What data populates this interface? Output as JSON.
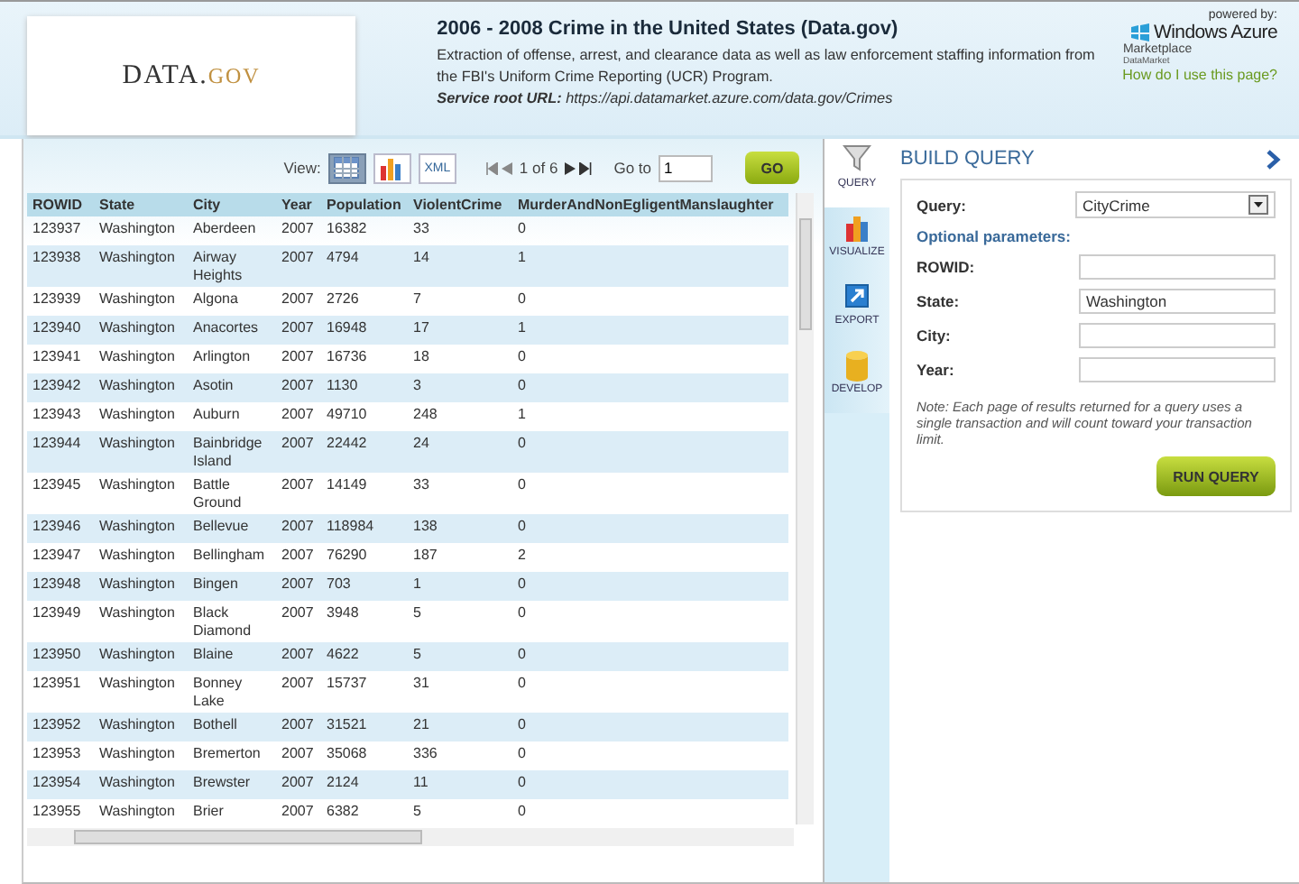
{
  "header": {
    "logo_main": "DATA.",
    "logo_accent": "GOV",
    "title": "2006 - 2008 Crime in the United States (Data.gov)",
    "description": "Extraction of offense, arrest, and clearance data as well as law enforcement staffing information from the FBI's Uniform Crime Reporting (UCR) Program.",
    "service_root": "**Service root URL:** https://api.datamarket.azure.com/data.gov/Crimes",
    "powered_by": "powered by:",
    "brand": "Windows Azure",
    "brand_sub": "Marketplace",
    "brand_sub2": "DataMarket",
    "help_link": "How do I use this page?"
  },
  "toolbar": {
    "view_label": "View:",
    "views": [
      {
        "kind": "table",
        "selected": true
      },
      {
        "kind": "chart",
        "selected": false
      },
      {
        "kind": "xml",
        "label": "XML",
        "selected": false
      }
    ],
    "page": "1 of 6",
    "goto_label": "Go to",
    "goto_value": "1",
    "go_button": "GO"
  },
  "table": {
    "columns": [
      "ROWID",
      "State",
      "City",
      "Year",
      "Population",
      "ViolentCrime",
      "MurderAndNonEgligentManslaughter"
    ],
    "rows": [
      [
        "123937",
        "Washington",
        "Aberdeen",
        "2007",
        "16382",
        "33",
        "0"
      ],
      [
        "123938",
        "Washington",
        "Airway Heights",
        "2007",
        "4794",
        "14",
        "1"
      ],
      [
        "123939",
        "Washington",
        "Algona",
        "2007",
        "2726",
        "7",
        "0"
      ],
      [
        "123940",
        "Washington",
        "Anacortes",
        "2007",
        "16948",
        "17",
        "1"
      ],
      [
        "123941",
        "Washington",
        "Arlington",
        "2007",
        "16736",
        "18",
        "0"
      ],
      [
        "123942",
        "Washington",
        "Asotin",
        "2007",
        "1130",
        "3",
        "0"
      ],
      [
        "123943",
        "Washington",
        "Auburn",
        "2007",
        "49710",
        "248",
        "1"
      ],
      [
        "123944",
        "Washington",
        "Bainbridge Island",
        "2007",
        "22442",
        "24",
        "0"
      ],
      [
        "123945",
        "Washington",
        "Battle Ground",
        "2007",
        "14149",
        "33",
        "0"
      ],
      [
        "123946",
        "Washington",
        "Bellevue",
        "2007",
        "118984",
        "138",
        "0"
      ],
      [
        "123947",
        "Washington",
        "Bellingham",
        "2007",
        "76290",
        "187",
        "2"
      ],
      [
        "123948",
        "Washington",
        "Bingen",
        "2007",
        "703",
        "1",
        "0"
      ],
      [
        "123949",
        "Washington",
        "Black Diamond",
        "2007",
        "3948",
        "5",
        "0"
      ],
      [
        "123950",
        "Washington",
        "Blaine",
        "2007",
        "4622",
        "5",
        "0"
      ],
      [
        "123951",
        "Washington",
        "Bonney Lake",
        "2007",
        "15737",
        "31",
        "0"
      ],
      [
        "123952",
        "Washington",
        "Bothell",
        "2007",
        "31521",
        "21",
        "0"
      ],
      [
        "123953",
        "Washington",
        "Bremerton",
        "2007",
        "35068",
        "336",
        "0"
      ],
      [
        "123954",
        "Washington",
        "Brewster",
        "2007",
        "2124",
        "11",
        "0"
      ],
      [
        "123955",
        "Washington",
        "Brier",
        "2007",
        "6382",
        "5",
        "0"
      ]
    ]
  },
  "side_tabs": [
    {
      "kind": "query",
      "label": "QUERY",
      "selected": true
    },
    {
      "kind": "visualize",
      "label": "VISUALIZE",
      "selected": false
    },
    {
      "kind": "export",
      "label": "EXPORT",
      "selected": false
    },
    {
      "kind": "develop",
      "label": "DEVELOP",
      "selected": false
    }
  ],
  "build_query": {
    "title": "BUILD QUERY",
    "query_label": "Query:",
    "query_value": "CityCrime",
    "optional_label": "Optional parameters:",
    "fields": [
      {
        "label": "ROWID:"
      },
      {
        "label": "State:",
        "value": "Washington"
      },
      {
        "label": "City:"
      },
      {
        "label": "Year:"
      }
    ],
    "note": "Note: Each page of results returned for a query uses a single transaction and will count toward your transaction limit.",
    "run_button": "RUN QUERY"
  }
}
